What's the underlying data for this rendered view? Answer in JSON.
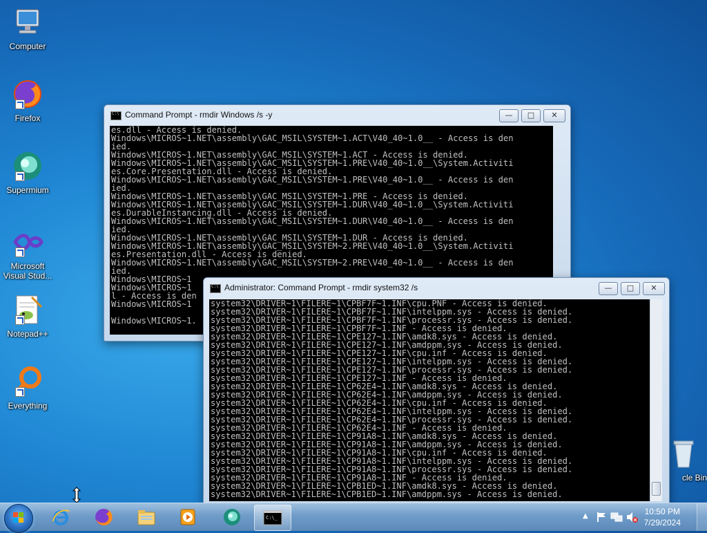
{
  "desktop": {
    "icons": [
      {
        "label": "Computer",
        "icon": "computer-icon"
      },
      {
        "label": "Firefox",
        "icon": "firefox-icon"
      },
      {
        "label": "Supermium",
        "icon": "supermium-icon"
      },
      {
        "label": "Microsoft Visual Stud...",
        "icon": "visual-studio-icon"
      },
      {
        "label": "Notepad++",
        "icon": "notepad-plus-plus-icon"
      },
      {
        "label": "Everything",
        "icon": "everything-icon"
      },
      {
        "label": "cle Bin",
        "icon": "recycle-bin-icon"
      }
    ]
  },
  "window1": {
    "title": "Command Prompt - rmdir  Windows /s -y",
    "lines": [
      "es.dll - Access is denied.",
      "Windows\\MICROS~1.NET\\assembly\\GAC_MSIL\\SYSTEM~1.ACT\\V40_40~1.0__ - Access is den",
      "ied.",
      "Windows\\MICROS~1.NET\\assembly\\GAC_MSIL\\SYSTEM~1.ACT - Access is denied.",
      "Windows\\MICROS~1.NET\\assembly\\GAC_MSIL\\SYSTEM~1.PRE\\V40_40~1.0__\\System.Activiti",
      "es.Core.Presentation.dll - Access is denied.",
      "Windows\\MICROS~1.NET\\assembly\\GAC_MSIL\\SYSTEM~1.PRE\\V40_40~1.0__ - Access is den",
      "ied.",
      "Windows\\MICROS~1.NET\\assembly\\GAC_MSIL\\SYSTEM~1.PRE - Access is denied.",
      "Windows\\MICROS~1.NET\\assembly\\GAC_MSIL\\SYSTEM~1.DUR\\V40_40~1.0__\\System.Activiti",
      "es.DurableInstancing.dll - Access is denied.",
      "Windows\\MICROS~1.NET\\assembly\\GAC_MSIL\\SYSTEM~1.DUR\\V40_40~1.0__ - Access is den",
      "ied.",
      "Windows\\MICROS~1.NET\\assembly\\GAC_MSIL\\SYSTEM~1.DUR - Access is denied.",
      "Windows\\MICROS~1.NET\\assembly\\GAC_MSIL\\SYSTEM~2.PRE\\V40_40~1.0__\\System.Activiti",
      "es.Presentation.dll - Access is denied.",
      "Windows\\MICROS~1.NET\\assembly\\GAC_MSIL\\SYSTEM~2.PRE\\V40_40~1.0__ - Access is den",
      "ied.",
      "Windows\\MICROS~1",
      "Windows\\MICROS~1",
      "l - Access is den",
      "Windows\\MICROS~1",
      "",
      "Windows\\MICROS~1."
    ]
  },
  "window2": {
    "title": "Administrator:  Command Prompt - rmdir  system32 /s",
    "lines": [
      "system32\\DRIVER~1\\FILERE~1\\CPBF7F~1.INF\\cpu.PNF - Access is denied.",
      "system32\\DRIVER~1\\FILERE~1\\CPBF7F~1.INF\\intelppm.sys - Access is denied.",
      "system32\\DRIVER~1\\FILERE~1\\CPBF7F~1.INF\\processr.sys - Access is denied.",
      "system32\\DRIVER~1\\FILERE~1\\CPBF7F~1.INF - Access is denied.",
      "system32\\DRIVER~1\\FILERE~1\\CPE127~1.INF\\amdk8.sys - Access is denied.",
      "system32\\DRIVER~1\\FILERE~1\\CPE127~1.INF\\amdppm.sys - Access is denied.",
      "system32\\DRIVER~1\\FILERE~1\\CPE127~1.INF\\cpu.inf - Access is denied.",
      "system32\\DRIVER~1\\FILERE~1\\CPE127~1.INF\\intelppm.sys - Access is denied.",
      "system32\\DRIVER~1\\FILERE~1\\CPE127~1.INF\\processr.sys - Access is denied.",
      "system32\\DRIVER~1\\FILERE~1\\CPE127~1.INF - Access is denied.",
      "system32\\DRIVER~1\\FILERE~1\\CP62E4~1.INF\\amdk8.sys - Access is denied.",
      "system32\\DRIVER~1\\FILERE~1\\CP62E4~1.INF\\amdppm.sys - Access is denied.",
      "system32\\DRIVER~1\\FILERE~1\\CP62E4~1.INF\\cpu.inf - Access is denied.",
      "system32\\DRIVER~1\\FILERE~1\\CP62E4~1.INF\\intelppm.sys - Access is denied.",
      "system32\\DRIVER~1\\FILERE~1\\CP62E4~1.INF\\processr.sys - Access is denied.",
      "system32\\DRIVER~1\\FILERE~1\\CP62E4~1.INF - Access is denied.",
      "system32\\DRIVER~1\\FILERE~1\\CP91A8~1.INF\\amdk8.sys - Access is denied.",
      "system32\\DRIVER~1\\FILERE~1\\CP91A8~1.INF\\amdppm.sys - Access is denied.",
      "system32\\DRIVER~1\\FILERE~1\\CP91A8~1.INF\\cpu.inf - Access is denied.",
      "system32\\DRIVER~1\\FILERE~1\\CP91A8~1.INF\\intelppm.sys - Access is denied.",
      "system32\\DRIVER~1\\FILERE~1\\CP91A8~1.INF\\processr.sys - Access is denied.",
      "system32\\DRIVER~1\\FILERE~1\\CP91A8~1.INF - Access is denied.",
      "system32\\DRIVER~1\\FILERE~1\\CPB1ED~1.INF\\amdk8.sys - Access is denied.",
      "system32\\DRIVER~1\\FILERE~1\\CPB1ED~1.INF\\amdppm.sys - Access is denied."
    ]
  },
  "window_controls": {
    "minimize": "—",
    "maximize": "□",
    "close": "✕"
  },
  "taskbar": {
    "buttons": [
      {
        "icon": "internet-explorer-icon"
      },
      {
        "icon": "firefox-icon"
      },
      {
        "icon": "file-explorer-icon"
      },
      {
        "icon": "media-player-icon"
      },
      {
        "icon": "supermium-icon"
      },
      {
        "icon": "command-prompt-icon"
      }
    ],
    "clock": {
      "time": "10:50 PM",
      "date": "7/29/2024"
    }
  },
  "colors": {
    "console_bg": "#000000",
    "console_text": "#c0c0c0",
    "desktop": "#1f86d3"
  }
}
